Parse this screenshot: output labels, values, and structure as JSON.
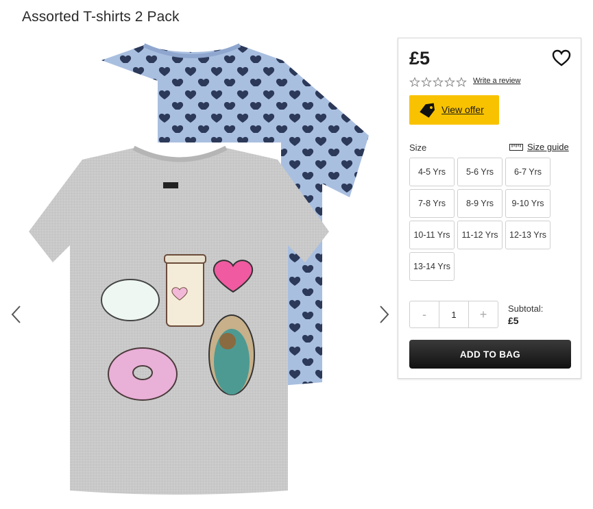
{
  "product": {
    "title": "Assorted T-shirts 2 Pack",
    "price": "£5",
    "rating_icon": "empty-star-icon",
    "rating_count_shown": 0,
    "write_review": "Write a review"
  },
  "offer": {
    "label": "View offer",
    "icon": "tag-icon",
    "color": "#f8c200"
  },
  "size": {
    "label": "Size",
    "guide_label": "Size guide",
    "options": [
      "4-5 Yrs",
      "5-6 Yrs",
      "6-7 Yrs",
      "7-8 Yrs",
      "8-9 Yrs",
      "9-10 Yrs",
      "10-11 Yrs",
      "11-12 Yrs",
      "12-13 Yrs",
      "13-14 Yrs"
    ]
  },
  "quantity": {
    "decrement": "-",
    "value": "1",
    "increment": "+"
  },
  "subtotal": {
    "label": "Subtotal:",
    "value": "£5"
  },
  "add_to_bag": "ADD TO BAG",
  "gallery": {
    "prev_icon": "chevron-left-icon",
    "next_icon": "chevron-right-icon"
  },
  "colors": {
    "accent_yellow": "#f8c200",
    "button_dark": "#1f1f1f",
    "shirt_blue": "#a9bfe0",
    "shirt_grey": "#cfcfcf",
    "heart_navy": "#1e2a4a"
  }
}
